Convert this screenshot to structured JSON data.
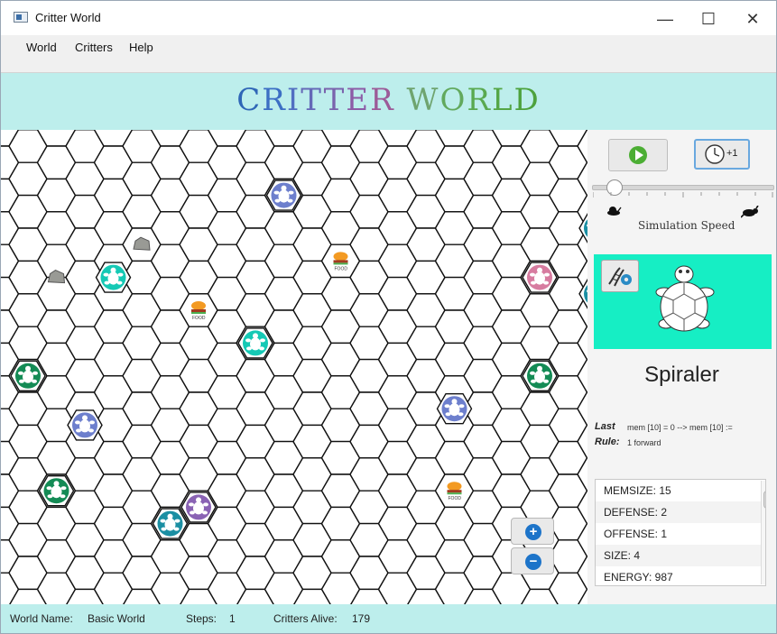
{
  "window": {
    "title": "Critter World",
    "minimize_glyph": "—",
    "maximize_glyph": "☐",
    "close_glyph": "✕"
  },
  "menu": [
    "World",
    "Critters",
    "Help"
  ],
  "banner": {
    "letters": [
      "C",
      "R",
      "I",
      "T",
      "T",
      "E",
      "R",
      " ",
      "W",
      "O",
      "R",
      "L",
      "D"
    ],
    "colors": [
      "#2f66b7",
      "#3c6fc4",
      "#526fc1",
      "#6569b7",
      "#7a63ad",
      "#8c5ba6",
      "#9c5b98",
      "#ffffff",
      "#6fa46f",
      "#62a95d",
      "#59a94f",
      "#55a646",
      "#4da23d"
    ]
  },
  "controls": {
    "play_icon": "play-icon",
    "step_icon": "clock-step-icon",
    "step_label": "+1",
    "speed_value": 0.12,
    "speed_label": "Simulation Speed",
    "slow_icon": "snail-icon",
    "fast_icon": "rabbit-icon"
  },
  "selected_critter": {
    "name": "Spiraler",
    "preview_icon": "turtle-icon",
    "edit_icon": "dna-gear-icon",
    "last_rule_label_1": "Last",
    "last_rule_label_2": "Rule:",
    "last_rule_line_1": "mem [10] = 0  --> mem [10] :=",
    "last_rule_line_2": "1  forward",
    "stats": [
      "MEMSIZE: 15",
      "DEFENSE: 2",
      "OFFENSE: 1",
      "SIZE: 4",
      "ENERGY: 987"
    ]
  },
  "status": {
    "world_name_label": "World Name:",
    "world_name_value": "Basic World",
    "steps_label": "Steps:",
    "steps_value": "1",
    "alive_label": "Critters Alive:",
    "alive_value": "179"
  },
  "board": {
    "food_label": "FOOD",
    "critter_types": {
      "green": "#148b55",
      "teal": "#1b8fa3",
      "blue": "#6d7fcd",
      "aqua": "#15c9b5",
      "pink": "#d77ca0",
      "purple": "#8a63b4",
      "brown": "#9a6b2e"
    },
    "critters": [
      {
        "col": 9,
        "row": 3,
        "type": "blue"
      },
      {
        "col": 23,
        "row": 3,
        "type": "blue"
      },
      {
        "col": 21,
        "row": 4,
        "type": "brown"
      },
      {
        "col": 20,
        "row": 5,
        "type": "teal"
      },
      {
        "col": 3,
        "row": 8,
        "type": "aqua"
      },
      {
        "col": 18,
        "row": 8,
        "type": "pink"
      },
      {
        "col": 20,
        "row": 9,
        "type": "teal"
      },
      {
        "col": 8,
        "row": 12,
        "type": "aqua"
      },
      {
        "col": 28,
        "row": 12,
        "type": "green"
      },
      {
        "col": 26,
        "row": 13,
        "type": "green"
      },
      {
        "col": 0,
        "row": 14,
        "type": "green"
      },
      {
        "col": 18,
        "row": 14,
        "type": "green"
      },
      {
        "col": 15,
        "row": 16,
        "type": "blue"
      },
      {
        "col": 25,
        "row": 16,
        "type": "green"
      },
      {
        "col": 2,
        "row": 17,
        "type": "blue"
      },
      {
        "col": 25,
        "row": 18,
        "type": "teal"
      },
      {
        "col": 27,
        "row": 19,
        "type": "teal"
      },
      {
        "col": 22,
        "row": 20,
        "type": "green"
      },
      {
        "col": 1,
        "row": 21,
        "type": "green"
      },
      {
        "col": 6,
        "row": 22,
        "type": "purple"
      },
      {
        "col": 5,
        "row": 23,
        "type": "teal"
      },
      {
        "col": 25,
        "row": 25,
        "type": "green"
      },
      {
        "col": 27,
        "row": 26,
        "type": "teal"
      }
    ],
    "food": [
      {
        "col": 11,
        "row": 7
      },
      {
        "col": 6,
        "row": 10
      },
      {
        "col": 15,
        "row": 21
      }
    ],
    "rocks": [
      {
        "col": 4,
        "row": 6
      },
      {
        "col": 1,
        "row": 8
      },
      {
        "col": 27,
        "row": 9
      },
      {
        "col": 20,
        "row": 24
      }
    ]
  },
  "zoom": {
    "in_glyph": "+",
    "out_glyph": "−"
  }
}
